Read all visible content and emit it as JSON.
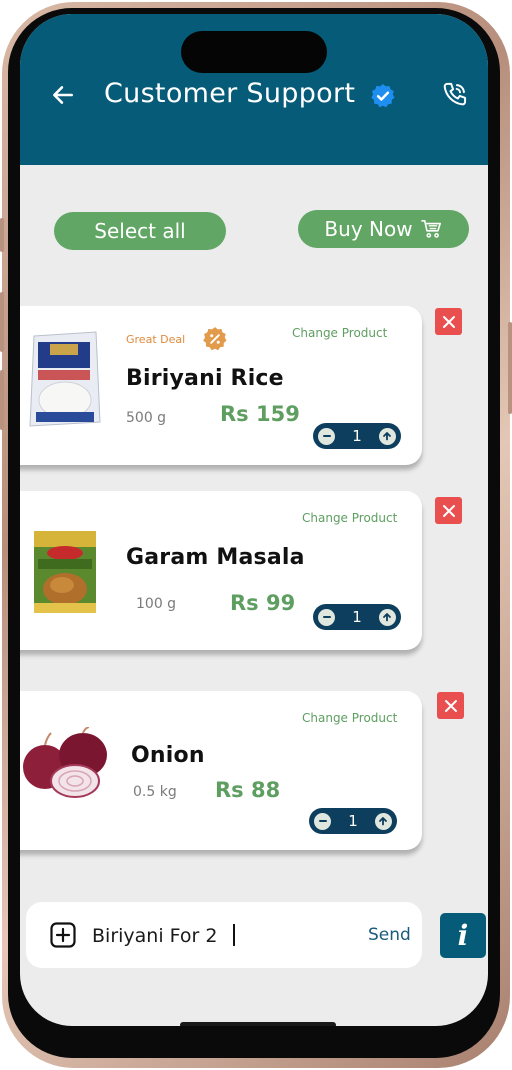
{
  "header": {
    "title": "Customer Support",
    "back_icon": "back-arrow-icon",
    "verified_icon": "verified-badge-icon",
    "call_icon": "phone-icon",
    "color": "#065b78"
  },
  "actions": {
    "select_all": "Select all",
    "buy_now": "Buy Now",
    "buy_now_icon": "cart-icon",
    "color": "#62a665"
  },
  "products": [
    {
      "name": "Biriyani Rice",
      "weight": "500 g",
      "price": "Rs 159",
      "quantity": "1",
      "badge": "Great Deal",
      "badge_icon": "discount-badge-icon",
      "change_label": "Change Product",
      "image": "rice-bag-image"
    },
    {
      "name": "Garam Masala",
      "weight": "100 g",
      "price": "Rs 99",
      "quantity": "1",
      "change_label": "Change Product",
      "image": "masala-pack-image"
    },
    {
      "name": "Onion",
      "weight": "0.5 kg",
      "price": "Rs 88",
      "quantity": "1",
      "change_label": "Change Product",
      "image": "onion-image"
    }
  ],
  "chat": {
    "input_value": "Biriyani For 2",
    "send_label": "Send",
    "attach_icon": "plus-square-icon",
    "info_label": "i"
  }
}
